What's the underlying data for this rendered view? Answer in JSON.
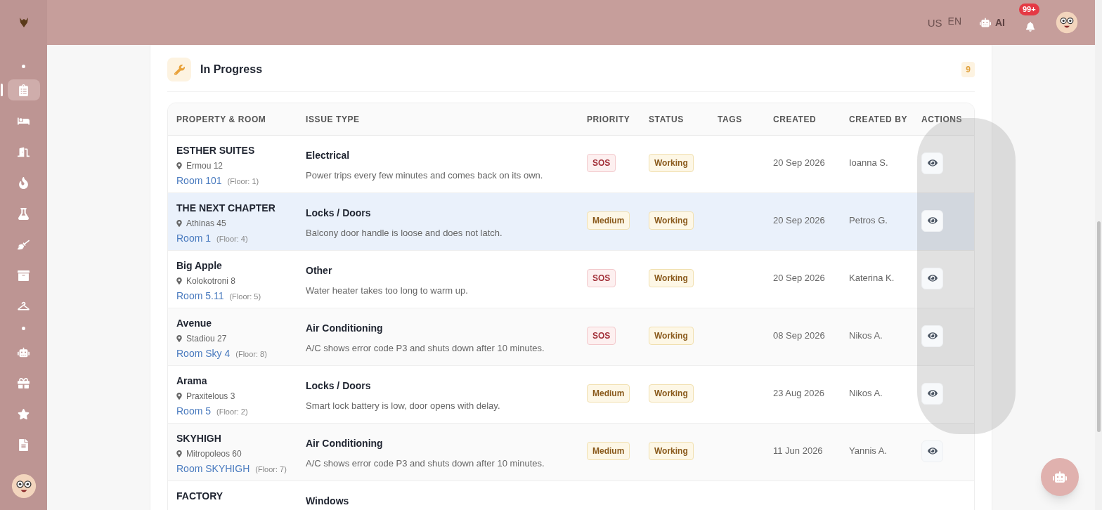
{
  "topbar": {
    "region": "US",
    "language": "EN",
    "ai_label": "AI",
    "notifications_badge": "99+"
  },
  "sidebar": {
    "items": [
      {
        "selected": true
      },
      {
        "selected": false
      },
      {
        "selected": false
      },
      {
        "selected": false
      },
      {
        "selected": false
      },
      {
        "selected": false
      },
      {
        "selected": false
      },
      {
        "selected": false
      },
      {
        "selected": false
      },
      {
        "selected": false
      },
      {
        "selected": false
      },
      {
        "selected": false
      }
    ]
  },
  "section": {
    "title": "In Progress",
    "count": "9"
  },
  "table": {
    "columns": [
      "PROPERTY & ROOM",
      "ISSUE TYPE",
      "PRIORITY",
      "STATUS",
      "TAGS",
      "CREATED",
      "CREATED BY",
      "ACTIONS"
    ],
    "rows": [
      {
        "property": "ESTHER SUITES",
        "address": "Ermou 12",
        "room": "Room 101",
        "floor": "(Floor: 1)",
        "issue": "Electrical",
        "description": "Power trips every few minutes and comes back on its own.",
        "priority": {
          "label": "SOS",
          "kind": "sos"
        },
        "status": "Working",
        "created": "20 Sep 2026",
        "created_by": "Ioanna S.",
        "selected": false
      },
      {
        "property": "THE NEXT CHAPTER",
        "address": "Athinas 45",
        "room": "Room 1",
        "floor": "(Floor: 4)",
        "issue": "Locks / Doors",
        "description": "Balcony door handle is loose and does not latch.",
        "priority": {
          "label": "Medium",
          "kind": "medium"
        },
        "status": "Working",
        "created": "20 Sep 2026",
        "created_by": "Petros G.",
        "selected": true
      },
      {
        "property": "Big Apple",
        "address": "Kolokotroni 8",
        "room": "Room 5.11",
        "floor": "(Floor: 5)",
        "issue": "Other",
        "description": "Water heater takes too long to warm up.",
        "priority": {
          "label": "SOS",
          "kind": "sos"
        },
        "status": "Working",
        "created": "20 Sep 2026",
        "created_by": "Katerina K.",
        "selected": false
      },
      {
        "property": "Avenue",
        "address": "Stadiou 27",
        "room": "Room Sky 4",
        "floor": "(Floor: 8)",
        "issue": "Air Conditioning",
        "description": "A/C shows error code P3 and shuts down after 10 minutes.",
        "priority": {
          "label": "SOS",
          "kind": "sos"
        },
        "status": "Working",
        "created": "08 Sep 2026",
        "created_by": "Nikos A.",
        "selected": false
      },
      {
        "property": "Arama",
        "address": "Praxitelous 3",
        "room": "Room 5",
        "floor": "(Floor: 2)",
        "issue": "Locks / Doors",
        "description": "Smart lock battery is low, door opens with delay.",
        "priority": {
          "label": "Medium",
          "kind": "medium"
        },
        "status": "Working",
        "created": "23 Aug 2026",
        "created_by": "Nikos A.",
        "selected": false
      },
      {
        "property": "SKYHIGH",
        "address": "Mitropoleos 60",
        "room": "Room SKYHIGH",
        "floor": "(Floor: 7)",
        "issue": "Air Conditioning",
        "description": "A/C shows error code P3 and shuts down after 10 minutes.",
        "priority": {
          "label": "Medium",
          "kind": "medium"
        },
        "status": "Working",
        "created": "11 Jun 2026",
        "created_by": "Yannis A.",
        "selected": false
      },
      {
        "property": "FACTORY",
        "issue": "Windows",
        "selected": false
      }
    ]
  }
}
